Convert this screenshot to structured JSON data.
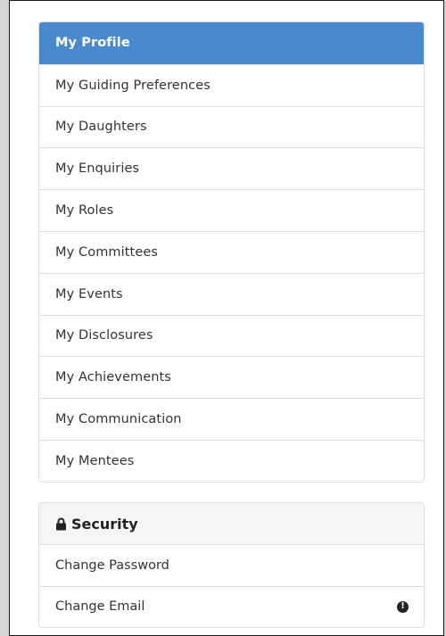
{
  "profile_menu": {
    "items": [
      {
        "label": "My Profile",
        "active": true
      },
      {
        "label": "My Guiding Preferences",
        "active": false
      },
      {
        "label": "My Daughters",
        "active": false
      },
      {
        "label": "My Enquiries",
        "active": false
      },
      {
        "label": "My Roles",
        "active": false
      },
      {
        "label": "My Committees",
        "active": false
      },
      {
        "label": "My Events",
        "active": false
      },
      {
        "label": "My Disclosures",
        "active": false
      },
      {
        "label": "My Achievements",
        "active": false
      },
      {
        "label": "My Communication",
        "active": false
      },
      {
        "label": "My Mentees",
        "active": false
      }
    ]
  },
  "security": {
    "title": "Security",
    "icon": "lock-icon",
    "items": [
      {
        "label": "Change Password",
        "alert": false
      },
      {
        "label": "Change Email",
        "alert": true
      }
    ]
  },
  "colors": {
    "active_bg": "#4a89cc",
    "border": "#dddddd",
    "header_bg": "#f5f5f5"
  }
}
